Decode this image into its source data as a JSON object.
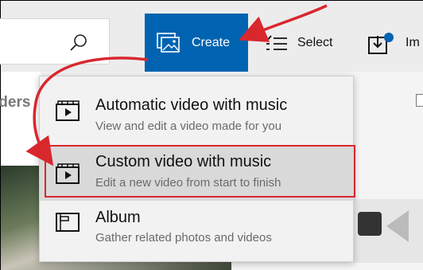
{
  "toolbar": {
    "create_label": "Create",
    "select_label": "Select",
    "import_label": "Im",
    "accent": "#0063b1"
  },
  "left_pane": {
    "folders_text": "lders"
  },
  "menu": {
    "items": [
      {
        "title": "Automatic video with music",
        "subtitle": "View and edit a video made for you",
        "icon": "video-film-icon"
      },
      {
        "title": "Custom video with music",
        "subtitle": "Edit a new video from start to finish",
        "icon": "video-film-icon"
      },
      {
        "title": "Album",
        "subtitle": "Gather related photos and videos",
        "icon": "album-icon"
      }
    ]
  },
  "annotation_color": "#d9272e"
}
